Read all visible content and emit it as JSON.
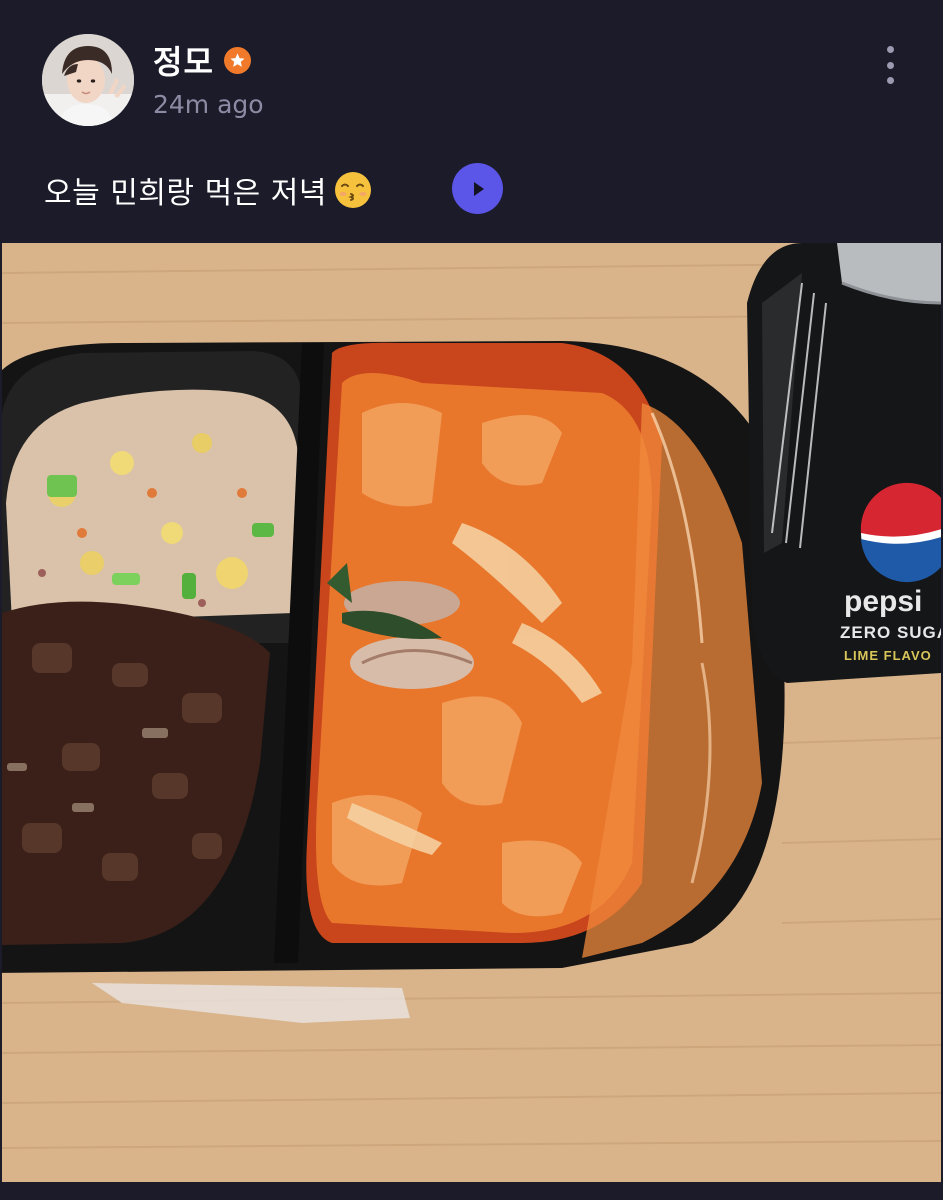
{
  "post": {
    "author": {
      "name": "정모",
      "avatar_alt": "avatar",
      "badge_icon": "star-badge-icon",
      "badge_color": "#f07a2a"
    },
    "timestamp": "24m ago",
    "caption": "오늘 민희랑 먹은 저녁",
    "caption_emoji": "kissing-face-emoji-icon",
    "translate_icon": "play-icon",
    "accent_color": "#5b55e8",
    "background_color": "#1c1b29",
    "photo": {
      "can_text": {
        "brand": "pepsi",
        "line1": "ZERO SUGA",
        "line2": "LIME FLAVO"
      }
    }
  }
}
